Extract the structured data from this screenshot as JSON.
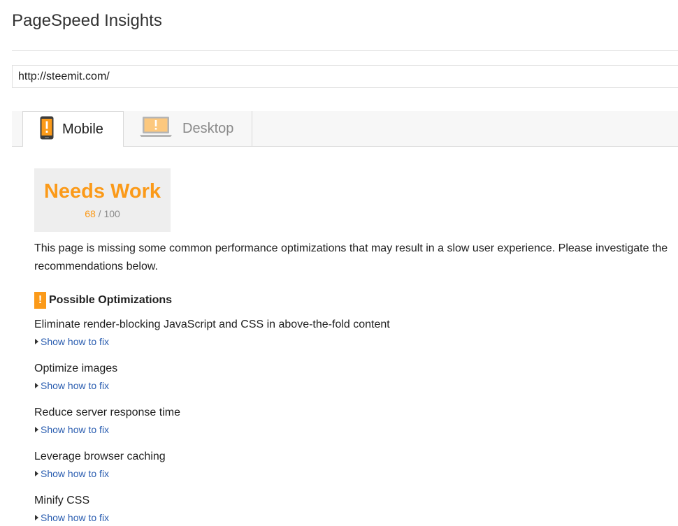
{
  "header": {
    "title": "PageSpeed Insights"
  },
  "url_field": {
    "value": "http://steemit.com/"
  },
  "tabs": [
    {
      "label": "Mobile",
      "active": true,
      "icon": "mobile-warning-icon"
    },
    {
      "label": "Desktop",
      "active": false,
      "icon": "laptop-warning-icon"
    }
  ],
  "score": {
    "status": "Needs Work",
    "value": "68",
    "separator": " / ",
    "max": "100"
  },
  "summary": "This page is missing some common performance optimizations that may result in a slow user experience. Please investigate the recommendations below.",
  "optimizations": {
    "badge": "!",
    "title": "Possible Optimizations",
    "link_label": "Show how to fix",
    "items": [
      "Eliminate render-blocking JavaScript and CSS in above-the-fold content",
      "Optimize images",
      "Reduce server response time",
      "Leverage browser caching",
      "Minify CSS"
    ]
  },
  "colors": {
    "warning": "#fb9a19",
    "link": "#2a5db0",
    "score_box_bg": "#eeeeee",
    "tab_bar_bg": "#f7f7f7"
  }
}
